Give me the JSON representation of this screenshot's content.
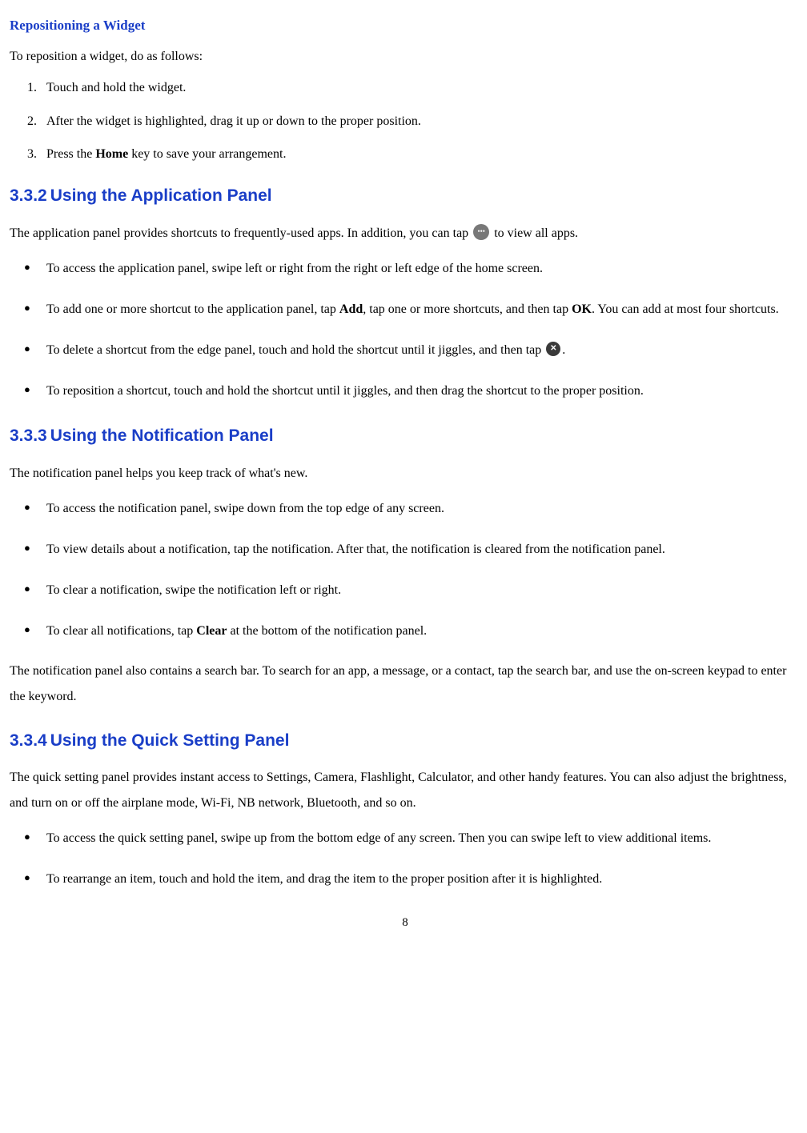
{
  "sec_reposition": {
    "title": "Repositioning a Widget",
    "intro": "To reposition a widget, do as follows:",
    "steps": [
      "Touch and hold the widget.",
      "After the widget is highlighted, drag it up or down to the proper position.",
      {
        "pre": "Press the ",
        "bold": "Home",
        "post": " key to save your arrangement."
      }
    ]
  },
  "sec_332": {
    "num": "3.3.2",
    "title": "Using the Application Panel",
    "intro_pre": "The application panel provides shortcuts to frequently-used apps. In addition, you can tap ",
    "intro_post": " to view all apps.",
    "bullets": [
      {
        "text": "To access the application panel, swipe left or right from the right or left edge of the home screen."
      },
      {
        "pre": "To add one or more shortcut to the application panel, tap ",
        "b1": "Add",
        "mid": ", tap one or more shortcuts, and then tap ",
        "b2": "OK",
        "post": ". You can add at most four shortcuts."
      },
      {
        "pre": "To delete a shortcut from the edge panel, touch and hold the shortcut until it jiggles, and then tap ",
        "post": "."
      },
      {
        "text": "To reposition a shortcut, touch and hold the shortcut until it jiggles, and then drag the shortcut to the proper position."
      }
    ]
  },
  "sec_333": {
    "num": "3.3.3",
    "title": "Using the Notification Panel",
    "intro": "The notification panel helps you keep track of what's new.",
    "bullets": [
      {
        "text": "To access the notification panel, swipe down from the top edge of any screen."
      },
      {
        "text": "To view details about a notification, tap the notification. After that, the notification is cleared from the notification panel."
      },
      {
        "text": "To clear a notification, swipe the notification left or right."
      },
      {
        "pre": "To clear all notifications, tap ",
        "b1": "Clear",
        "post": " at the bottom of the notification panel."
      }
    ],
    "outro": "The notification panel also contains a search bar. To search for an app, a message, or a contact, tap the search bar, and use the on-screen keypad to enter the keyword."
  },
  "sec_334": {
    "num": "3.3.4",
    "title": "Using the Quick Setting Panel",
    "intro": "The quick setting panel provides instant access to Settings, Camera, Flashlight, Calculator, and other handy features. You can also adjust the brightness, and turn on or off the airplane mode, Wi-Fi, NB network, Bluetooth, and so on.",
    "bullets": [
      {
        "text": "To access the quick setting panel, swipe up from the bottom edge of any screen. Then you can swipe left to view additional items."
      },
      {
        "text": "To rearrange an item, touch and hold the item, and drag the item to the proper position after it is highlighted."
      }
    ]
  },
  "page_number": "8"
}
